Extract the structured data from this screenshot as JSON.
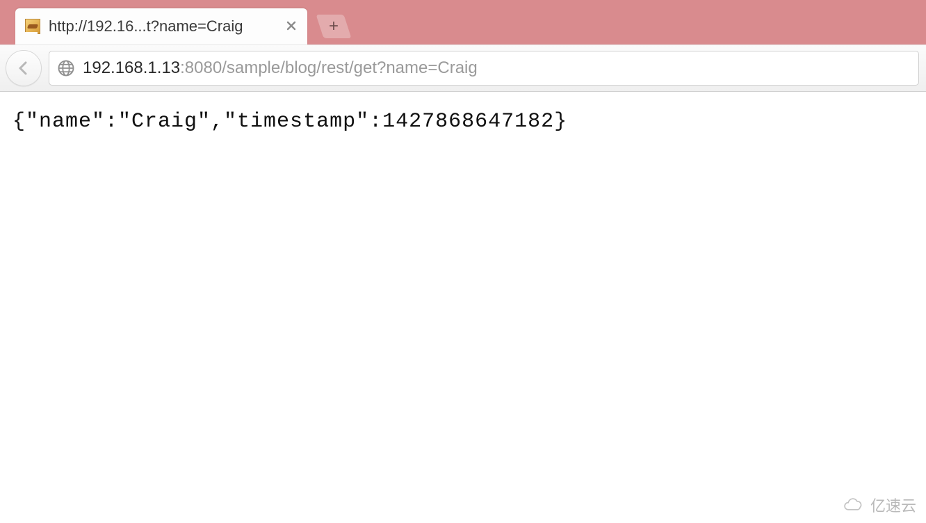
{
  "tab": {
    "title": "http://192.16...t?name=Craig"
  },
  "addressbar": {
    "host": "192.168.1.13",
    "path": ":8080/sample/blog/rest/get?name=Craig"
  },
  "page": {
    "body_text": "{\"name\":\"Craig\",\"timestamp\":1427868647182}"
  },
  "watermark": {
    "text": "亿速云"
  }
}
